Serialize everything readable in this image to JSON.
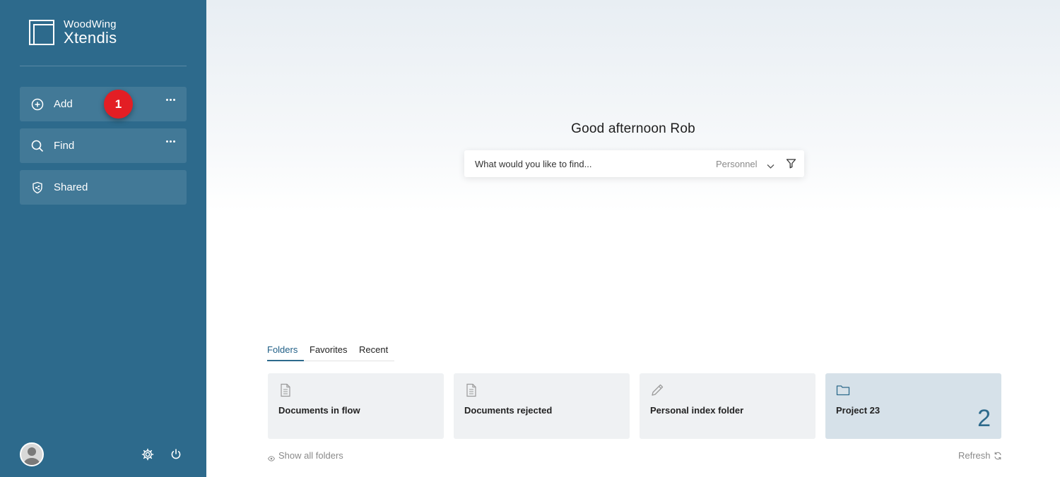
{
  "sidebar": {
    "logo": {
      "brand": "WoodWing",
      "product": "Xtendis"
    },
    "items": [
      {
        "label": "Add",
        "icon": "plus-circle-icon",
        "has_more": true
      },
      {
        "label": "Find",
        "icon": "search-icon",
        "has_more": true
      },
      {
        "label": "Shared",
        "icon": "shield-share-icon",
        "has_more": false
      }
    ],
    "annotation_badge": "1",
    "footer": {
      "avatar": "user-avatar",
      "settings_icon": "gear-icon",
      "power_icon": "power-icon"
    }
  },
  "main": {
    "greeting": "Good afternoon Rob",
    "search": {
      "placeholder": "What would you like to find...",
      "scope": "Personnel",
      "chevron_icon": "chevron-down-icon",
      "filter_icon": "filter-icon"
    },
    "tabs": [
      {
        "label": "Folders",
        "active": true
      },
      {
        "label": "Favorites",
        "active": false
      },
      {
        "label": "Recent",
        "active": false
      }
    ],
    "folders": [
      {
        "title": "Documents in flow",
        "icon": "document-icon",
        "count": ""
      },
      {
        "title": "Documents rejected",
        "icon": "document-icon",
        "count": ""
      },
      {
        "title": "Personal index folder",
        "icon": "pencil-icon",
        "count": ""
      },
      {
        "title": "Project 23",
        "icon": "folder-icon",
        "count": "2"
      }
    ],
    "show_all_label": "Show all folders",
    "refresh_label": "Refresh"
  },
  "colors": {
    "sidebar": "#2d6a8c",
    "accent": "#2d6a8c",
    "badge": "#e31e24",
    "card": "#eff1f3",
    "card_highlight": "#d6e1e9"
  }
}
